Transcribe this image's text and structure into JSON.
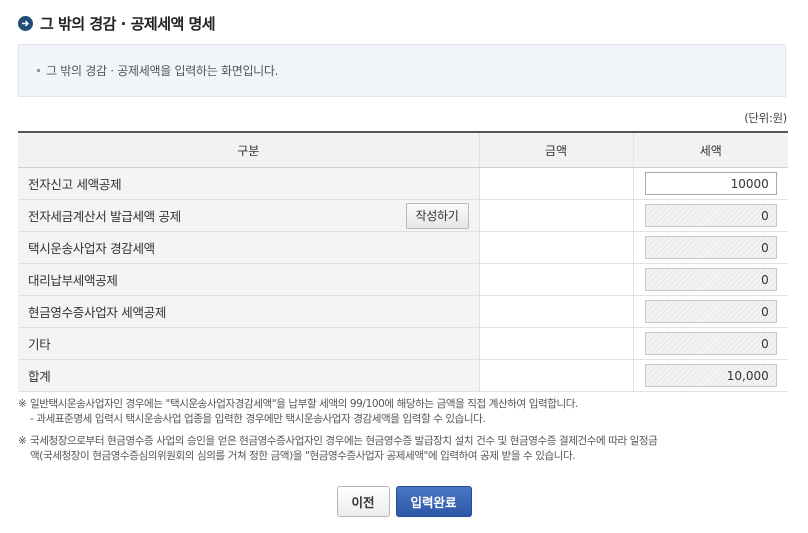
{
  "page": {
    "title": "그 밖의 경감 · 공제세액 명세",
    "info_text": "그 밖의 경감 · 공제세액을 입력하는 화면입니다.",
    "unit": "(단위:원)"
  },
  "table": {
    "headers": {
      "category": "구분",
      "amount": "금액",
      "tax": "세액"
    },
    "rows": [
      {
        "label": "전자신고 세액공제",
        "tax": "10000"
      },
      {
        "label": "전자세금계산서 발급세액 공제",
        "tax": "0",
        "button": "작성하기"
      },
      {
        "label": "택시운송사업자 경감세액",
        "tax": "0"
      },
      {
        "label": "대리납부세액공제",
        "tax": "0"
      },
      {
        "label": "현금영수증사업자 세액공제",
        "tax": "0"
      },
      {
        "label": "기타",
        "tax": "0"
      },
      {
        "label": "합계",
        "tax": "10,000"
      }
    ]
  },
  "notes": [
    {
      "mark": "※",
      "line1": "일반택시운송사업자인 경우에는 \"택시운송사업자경감세액\"을 납부할 세액의 99/100에 해당하는 금액을 직접 계산하여 입력합니다.",
      "line2": "- 과세표준명세 입력시 택시운송사업 업종을 입력한 경우에만 택시운송사업자 경감세액을 입력할 수 있습니다."
    },
    {
      "mark": "※",
      "line1": "국세청장으로부터 현금영수증 사업의 승인을 얻은 현금영수증사업자인 경우에는 현금영수증 발급장치 설치 건수 및 현금영수증 결제건수에 따라 일정금",
      "line2": "액(국세청장이 현금영수증심의위원회의 심의를 거쳐 정한 금액)을 \"현금영수증사업자 공제세액\"에 입력하여 공제 받을 수 있습니다."
    }
  ],
  "buttons": {
    "prev": "이전",
    "done": "입력완료"
  },
  "icons": {
    "title": "arrow-right-circle-icon"
  },
  "colors": {
    "accent": "#2d58a8",
    "title_icon": "#1f4e79"
  }
}
